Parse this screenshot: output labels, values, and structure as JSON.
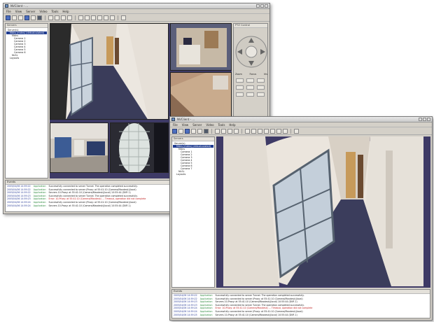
{
  "colors": {
    "video_bg": "#3e3a66",
    "selection": "#1f3b8f",
    "chrome": "#d4d0c8",
    "log_time": "#2d3f99",
    "log_source": "#2d8a3e",
    "log_error": "#c02020"
  },
  "back_window": {
    "title": "NVClient - ...",
    "menu": [
      "File",
      "View",
      "Server",
      "Video",
      "Tools",
      "Help"
    ],
    "sidebar_title": "Servers",
    "tree": [
      "Server(s)",
      "Mdns (mdns) (dirtcalculated)",
      "Mdns",
      "Camera 1",
      "Camera 2",
      "Camera 3",
      "Camera 4",
      "Camera 5",
      "Camera 6",
      "NLSL",
      "Layouts"
    ],
    "ptz_title": "PTZ Control",
    "ptz_labels": [
      "Zoom",
      "Focus",
      "Iris"
    ],
    "log_title": "Events",
    "log_rows": [
      {
        "time": "2005/04/06 14:59:22",
        "source": "Application",
        "msg": "Successfully connected to server Tunnel. The operation completed successfully.",
        "err": false
      },
      {
        "time": "2005/04/06 14:59:22",
        "source": "Application",
        "msg": "Successfully connected to server (Proxy: at 55:41:10 (Camera/Maxdesk)(local)",
        "err": false
      },
      {
        "time": "2005/04/06 14:59:22",
        "source": "Application",
        "msg": "Servers 10-Proxy: at 55:41:10 (Camera/Maxdesk)(local) 10:55:44 (DVR 1)",
        "err": false
      },
      {
        "time": "2005/04/06 14:59:23",
        "source": "Application",
        "msg": "Successfully connected to server Tunnel. The operation completed successfully.",
        "err": false
      },
      {
        "time": "2005/04/06 14:59:23",
        "source": "Application",
        "msg": "Error: 10-Proxy: at 55:41:10 (Camera/Maxdesk) ... Timeout, operation did not complete",
        "err": true
      },
      {
        "time": "2005/04/06 14:59:24",
        "source": "Application",
        "msg": "Successfully connected to server (Proxy: at 55:41:10 (Camera/Maxdesk)(local)",
        "err": false
      },
      {
        "time": "2005/04/06 14:59:24",
        "source": "Application",
        "msg": "Servers 10-Proxy: at 55:41:10 (Camera/Maxdesk)(local) 10:55:44 (DVR 1)",
        "err": false
      }
    ]
  },
  "front_window": {
    "title": "NVClient - ...",
    "menu": [
      "File",
      "View",
      "Server",
      "Video",
      "Tools",
      "Help"
    ],
    "sidebar_title": "Servers",
    "tree": [
      "Server(s)",
      "Mdns (mdns) (dirtcalculated)",
      "Mdns",
      "Camera 1",
      "Camera 2",
      "Camera 3",
      "Camera 4",
      "Camera 5",
      "Camera 6",
      "Camera 7",
      "NLSL",
      "Layouts"
    ],
    "log_title": "Events",
    "log_rows": [
      {
        "time": "2005/04/06 14:59:22",
        "source": "Application",
        "msg": "Successfully connected to server Tunnel. The operation completed successfully.",
        "err": false
      },
      {
        "time": "2005/04/06 14:59:22",
        "source": "Application",
        "msg": "Successfully connected to server (Proxy: at 55:41:10 (Camera/Maxdesk)(local)",
        "err": false
      },
      {
        "time": "2005/04/06 14:59:23",
        "source": "Application",
        "msg": "Servers 10-Proxy: at 55:41:10 (Camera/Maxdesk)(local) 10:55:44 (DVR 1)",
        "err": false
      },
      {
        "time": "2005/04/06 14:59:23",
        "source": "Application",
        "msg": "Successfully connected to server Tunnel. The operation completed successfully.",
        "err": false
      },
      {
        "time": "2005/04/06 14:59:24",
        "source": "Application",
        "msg": "Error: 10-Proxy: at 55:41:10 (Camera/Maxdesk) ... Timeout, operation did not complete",
        "err": true
      },
      {
        "time": "2005/04/06 14:59:24",
        "source": "Application",
        "msg": "Successfully connected to server (Proxy: at 55:41:10 (Camera/Maxdesk)(local)",
        "err": false
      },
      {
        "time": "2005/04/06 14:59:25",
        "source": "Application",
        "msg": "Servers 10-Proxy: at 55:41:10 (Camera/Maxdesk)(local) 10:55:44 (DVR 1)",
        "err": false
      }
    ]
  }
}
